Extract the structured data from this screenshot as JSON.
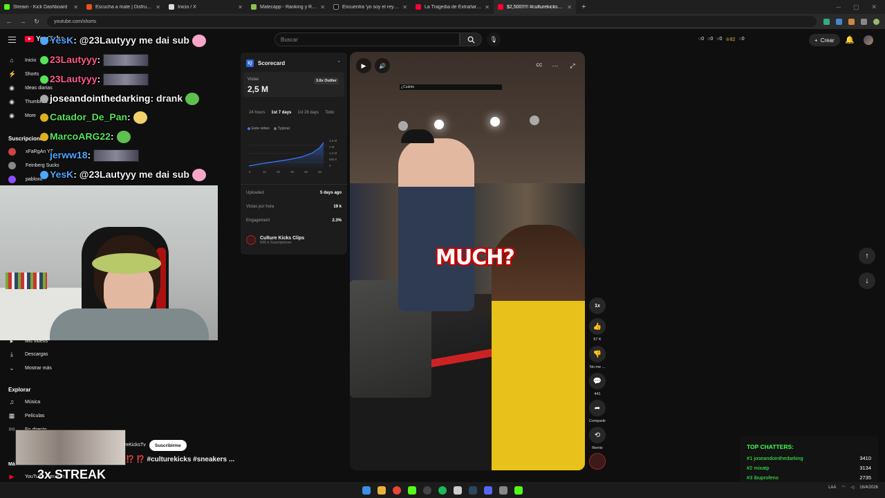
{
  "browser": {
    "tabs": [
      {
        "label": "Stream - Kick Dashboard",
        "color": "#53fc18",
        "active": false
      },
      {
        "label": "Escucha a mate | Disfruta de la",
        "color": "#e0531b",
        "active": false
      },
      {
        "label": "Inicio / X",
        "color": "#dddddd",
        "active": false
      },
      {
        "label": "Matecapp - Ranking y Racha d",
        "color": "#8bc34a",
        "active": false
      },
      {
        "label": "Encuentra 'yo soy el rey del un",
        "color": "#111111",
        "active": false
      },
      {
        "label": "La Tragedia de Extrañar el Pre",
        "color": "#ff0033",
        "active": false
      },
      {
        "label": "$2,500!!!!! #culturekicks #sne",
        "color": "#ff0033",
        "active": true
      }
    ],
    "new_tab": "+",
    "url": "youtube.com/shorts"
  },
  "header": {
    "logo_text": "YouTube",
    "logo_country": "AR",
    "search_placeholder": "Buscar",
    "stats": [
      {
        "icon": "○",
        "value": "0"
      },
      {
        "icon": "○",
        "value": "0"
      },
      {
        "icon": "○",
        "value": "0"
      },
      {
        "icon": "♔",
        "value": "82"
      },
      {
        "icon": "○",
        "value": "0"
      }
    ],
    "create_label": "Crear"
  },
  "sidebar": {
    "main_items": [
      {
        "icon": "⌂",
        "label": "Inicio"
      },
      {
        "icon": "⚡",
        "label": "Shorts"
      }
    ],
    "tool_items": [
      {
        "label": "Ideas diarias"
      },
      {
        "label": "Thumbnail ..."
      },
      {
        "label": "More"
      }
    ],
    "subs_heading": "Suscripciones",
    "subscriptions": [
      {
        "label": "xFaRgAn YT",
        "color": "#c44"
      },
      {
        "label": "Feinberg Sucks",
        "color": "#888"
      },
      {
        "label": "pabloxo",
        "color": "#8a4fff"
      }
    ],
    "lower_items": [
      {
        "icon": "▸",
        "label": "Mis videos"
      },
      {
        "icon": "⤓",
        "label": "Descargas"
      },
      {
        "icon": "⌄",
        "label": "Mostrar más"
      }
    ],
    "explore_heading": "Explorar",
    "explore_items": [
      {
        "icon": "♫",
        "label": "Música"
      },
      {
        "icon": "▦",
        "label": "Películas"
      },
      {
        "icon": "((•))",
        "label": "En directo"
      }
    ],
    "more_heading": "Más de YouTube",
    "more_items": [
      {
        "label": "YouTube Premium"
      }
    ]
  },
  "chat": [
    {
      "user": "YesK",
      "color": "#4ea7ff",
      "text": ": @23Lautyyy me dai sub",
      "emote": "small-pink"
    },
    {
      "user": "23Lautyyy",
      "color": "#ff5a8a",
      "text": ":",
      "emote": "wide"
    },
    {
      "user": "23Lautyyy",
      "color": "#ff5a8a",
      "text": ":",
      "emote": "wide"
    },
    {
      "user": "joseandointhedarking",
      "color": "#ffffff",
      "text": ": drank",
      "emote": "small-green"
    },
    {
      "user": "Catador_De_Pan",
      "color": "#57e35a",
      "text": ":",
      "emote": "small-yellow"
    },
    {
      "user": "MarcoARG22",
      "color": "#57e35a",
      "text": ":",
      "emote": "small-green"
    },
    {
      "user": "jerww18",
      "color": "#4ea7ff",
      "text": ":",
      "emote": "wide"
    },
    {
      "user": "YesK",
      "color": "#4ea7ff",
      "text": ": @23Lautyyy me dai sub",
      "emote": "small-pink"
    }
  ],
  "scorecard": {
    "title": "Scorecard",
    "views_label": "Vistas",
    "views_value": "2,5 M",
    "outlier": "3.6x Outlier",
    "tabs": [
      "24 hours",
      "1st 7 days",
      "1st 28 days",
      "Todo"
    ],
    "active_tab": "1st 7 days",
    "legend": [
      "Este video",
      "Typical"
    ],
    "chart_ticks_y": [
      "2,6 M",
      "2 M",
      "1,3 M",
      "650 k",
      "0"
    ],
    "chart_ticks_x": [
      "0",
      "10",
      "20",
      "30",
      "40",
      "50"
    ],
    "rows": [
      {
        "label": "Uploaded",
        "value": "5 days ago"
      },
      {
        "label": "Vistas por hora",
        "value": "19 k"
      },
      {
        "label": "Engagement",
        "value": "2.3%"
      }
    ],
    "channel_name": "Culture Kicks Clips",
    "channel_subs": "590 k Suscriptores"
  },
  "video": {
    "caption": "MUCH?",
    "small_label": "¿Cuánto",
    "play_icon": "▶",
    "volume_icon": "🔊",
    "cc_icon": "CC",
    "more_icon": "⋯",
    "expand_icon": "⤢"
  },
  "actions": {
    "speed": "1x",
    "likes": "57 K",
    "dislike": "No me ...",
    "comments": "441",
    "share": "Compartir",
    "remix": "Remix"
  },
  "bottom": {
    "channel": "reKicksTv",
    "subscribe": "Suscribirme",
    "title": "⁉️ ⁉️ #culturekicks #sneakers ...",
    "streak": "3x STREAK"
  },
  "top_chatters": {
    "title": "TOP CHATTERS:",
    "rows": [
      {
        "rank": "#1 joseandointhedarking",
        "score": "3410"
      },
      {
        "rank": "#2 mixatp",
        "score": "3134"
      },
      {
        "rank": "#3 ibuprofeno",
        "score": "2735"
      }
    ]
  },
  "tray": {
    "lang": "LAA",
    "date": "16/4/2026"
  }
}
